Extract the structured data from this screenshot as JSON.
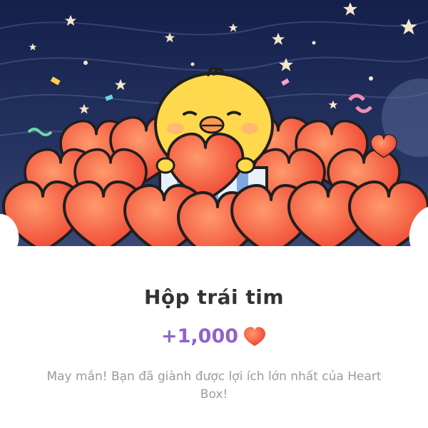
{
  "title": "Hộp trái tim",
  "reward": {
    "amount": "+1,000",
    "icon": "heart-icon",
    "color": "#8f63cc"
  },
  "description": "May mắn! Bạn đã giành được lợi ích lớn nhất của Heart Box!",
  "colors": {
    "sky": "#1e2a52",
    "heart": "#f2553a",
    "chick": "#ffd94d"
  }
}
